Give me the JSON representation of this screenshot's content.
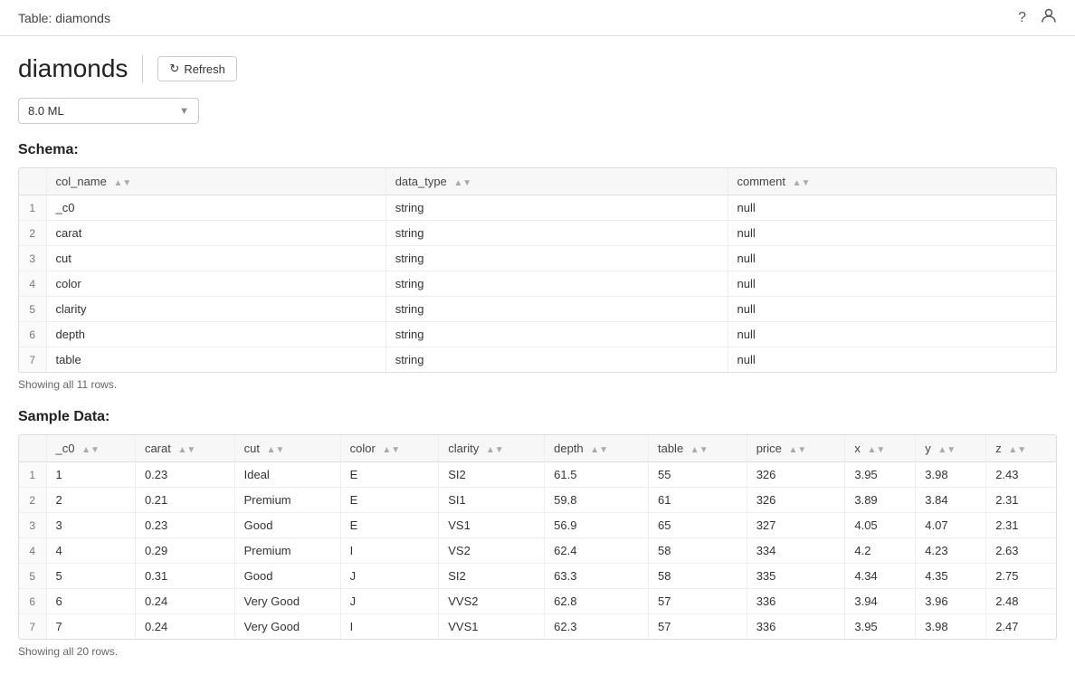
{
  "header": {
    "title": "Table: diamonds",
    "help_icon": "?",
    "user_icon": "👤"
  },
  "page": {
    "title": "diamonds",
    "refresh_label": "Refresh",
    "version_selected": "8.0 ML",
    "version_options": [
      "8.0 ML"
    ]
  },
  "schema": {
    "heading": "Schema:",
    "showing_text": "Showing all 11 rows.",
    "columns": [
      {
        "key": "col_name",
        "label": "col_name"
      },
      {
        "key": "data_type",
        "label": "data_type"
      },
      {
        "key": "comment",
        "label": "comment"
      }
    ],
    "rows": [
      {
        "num": 1,
        "col_name": "_c0",
        "data_type": "string",
        "comment": "null"
      },
      {
        "num": 2,
        "col_name": "carat",
        "data_type": "string",
        "comment": "null"
      },
      {
        "num": 3,
        "col_name": "cut",
        "data_type": "string",
        "comment": "null"
      },
      {
        "num": 4,
        "col_name": "color",
        "data_type": "string",
        "comment": "null"
      },
      {
        "num": 5,
        "col_name": "clarity",
        "data_type": "string",
        "comment": "null"
      },
      {
        "num": 6,
        "col_name": "depth",
        "data_type": "string",
        "comment": "null"
      },
      {
        "num": 7,
        "col_name": "table",
        "data_type": "string",
        "comment": "null"
      }
    ]
  },
  "sample_data": {
    "heading": "Sample Data:",
    "showing_text": "Showing all 20 rows.",
    "columns": [
      {
        "key": "_c0",
        "label": "_c0"
      },
      {
        "key": "carat",
        "label": "carat"
      },
      {
        "key": "cut",
        "label": "cut"
      },
      {
        "key": "color",
        "label": "color"
      },
      {
        "key": "clarity",
        "label": "clarity"
      },
      {
        "key": "depth",
        "label": "depth"
      },
      {
        "key": "table",
        "label": "table"
      },
      {
        "key": "price",
        "label": "price"
      },
      {
        "key": "x",
        "label": "x"
      },
      {
        "key": "y",
        "label": "y"
      },
      {
        "key": "z",
        "label": "z"
      }
    ],
    "rows": [
      {
        "num": 1,
        "_c0": "1",
        "carat": "0.23",
        "cut": "Ideal",
        "color": "E",
        "clarity": "SI2",
        "depth": "61.5",
        "table": "55",
        "price": "326",
        "x": "3.95",
        "y": "3.98",
        "z": "2.43"
      },
      {
        "num": 2,
        "_c0": "2",
        "carat": "0.21",
        "cut": "Premium",
        "color": "E",
        "clarity": "SI1",
        "depth": "59.8",
        "table": "61",
        "price": "326",
        "x": "3.89",
        "y": "3.84",
        "z": "2.31"
      },
      {
        "num": 3,
        "_c0": "3",
        "carat": "0.23",
        "cut": "Good",
        "color": "E",
        "clarity": "VS1",
        "depth": "56.9",
        "table": "65",
        "price": "327",
        "x": "4.05",
        "y": "4.07",
        "z": "2.31"
      },
      {
        "num": 4,
        "_c0": "4",
        "carat": "0.29",
        "cut": "Premium",
        "color": "I",
        "clarity": "VS2",
        "depth": "62.4",
        "table": "58",
        "price": "334",
        "x": "4.2",
        "y": "4.23",
        "z": "2.63"
      },
      {
        "num": 5,
        "_c0": "5",
        "carat": "0.31",
        "cut": "Good",
        "color": "J",
        "clarity": "SI2",
        "depth": "63.3",
        "table": "58",
        "price": "335",
        "x": "4.34",
        "y": "4.35",
        "z": "2.75"
      },
      {
        "num": 6,
        "_c0": "6",
        "carat": "0.24",
        "cut": "Very Good",
        "color": "J",
        "clarity": "VVS2",
        "depth": "62.8",
        "table": "57",
        "price": "336",
        "x": "3.94",
        "y": "3.96",
        "z": "2.48"
      },
      {
        "num": 7,
        "_c0": "7",
        "carat": "0.24",
        "cut": "Very Good",
        "color": "I",
        "clarity": "VVS1",
        "depth": "62.3",
        "table": "57",
        "price": "336",
        "x": "3.95",
        "y": "3.98",
        "z": "2.47"
      }
    ]
  }
}
